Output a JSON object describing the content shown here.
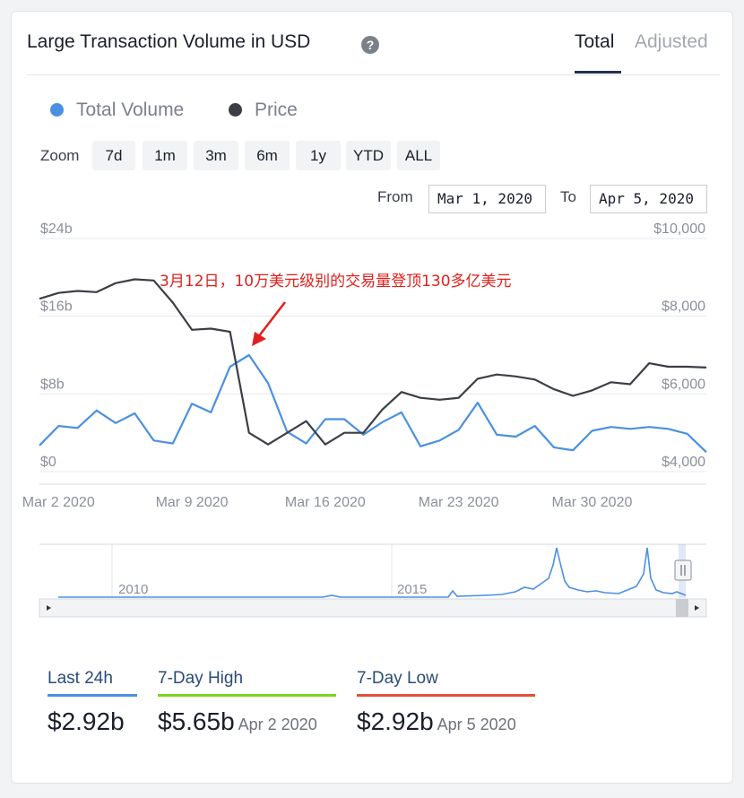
{
  "header": {
    "title": "Large Transaction Volume in USD",
    "help_icon": "question-circle-icon",
    "tabs": [
      {
        "label": "Total",
        "active": true
      },
      {
        "label": "Adjusted",
        "active": false
      }
    ]
  },
  "legend": [
    {
      "label": "Total Volume",
      "color": "#4a90e2"
    },
    {
      "label": "Price",
      "color": "#3b3f45"
    }
  ],
  "zoom": {
    "label": "Zoom",
    "options": [
      "7d",
      "1m",
      "3m",
      "6m",
      "1y",
      "YTD",
      "ALL"
    ]
  },
  "range": {
    "from_label": "From",
    "from_value": "Mar 1, 2020",
    "to_label": "To",
    "to_value": "Apr 5, 2020"
  },
  "annotation": {
    "text": "3月12日，10万美元级别的交易量登顶130多亿美元",
    "color": "#e0201b"
  },
  "chart_data": [
    {
      "type": "line",
      "x_dates": [
        "Mar 1",
        "Mar 2",
        "Mar 3",
        "Mar 4",
        "Mar 5",
        "Mar 6",
        "Mar 7",
        "Mar 8",
        "Mar 9",
        "Mar 10",
        "Mar 11",
        "Mar 12",
        "Mar 13",
        "Mar 14",
        "Mar 15",
        "Mar 16",
        "Mar 17",
        "Mar 18",
        "Mar 19",
        "Mar 20",
        "Mar 21",
        "Mar 22",
        "Mar 23",
        "Mar 24",
        "Mar 25",
        "Mar 26",
        "Mar 27",
        "Mar 28",
        "Mar 29",
        "Mar 30",
        "Mar 31",
        "Apr 1",
        "Apr 2",
        "Apr 3",
        "Apr 4",
        "Apr 5"
      ],
      "x_tick_labels": [
        "Mar 2 2020",
        "Mar 9 2020",
        "Mar 16 2020",
        "Mar 23 2020",
        "Mar 30 2020"
      ],
      "x_tick_index": [
        1,
        8,
        15,
        22,
        29
      ],
      "y_left": {
        "ticks": [
          "$0",
          "$8b",
          "$16b",
          "$24b"
        ],
        "range": [
          0,
          24
        ]
      },
      "y_right": {
        "ticks": [
          "$4,000",
          "$6,000",
          "$8,000",
          "$10,000"
        ],
        "range": [
          4000,
          10000
        ]
      },
      "series": [
        {
          "name": "Total Volume",
          "color": "#4a90e2",
          "axis": "left",
          "values": [
            2.7,
            4.7,
            4.5,
            6.3,
            5.0,
            6.0,
            3.2,
            2.9,
            7.0,
            6.1,
            10.8,
            12.0,
            9.1,
            4.1,
            2.9,
            5.4,
            5.4,
            3.8,
            5.1,
            6.1,
            2.6,
            3.2,
            4.3,
            7.1,
            3.8,
            3.6,
            4.7,
            2.5,
            2.2,
            4.2,
            4.6,
            4.4,
            4.6,
            4.4,
            3.9,
            2.0
          ]
        },
        {
          "name": "Price",
          "color": "#3b3f45",
          "axis": "right",
          "values": [
            8450,
            8600,
            8650,
            8620,
            8850,
            8950,
            8920,
            8350,
            7650,
            7680,
            7600,
            5000,
            4700,
            5000,
            5300,
            4700,
            5000,
            5000,
            5600,
            6050,
            5900,
            5850,
            5900,
            6390,
            6500,
            6450,
            6370,
            6120,
            5950,
            6090,
            6300,
            6250,
            6790,
            6700,
            6700,
            6680
          ]
        }
      ]
    },
    {
      "type": "area",
      "role": "navigator",
      "x_tick_labels": [
        "2010",
        "2015"
      ]
    }
  ],
  "stats": [
    {
      "label": "Last 24h",
      "value": "$2.92b",
      "date": "",
      "color": "#4a90e2"
    },
    {
      "label": "7-Day High",
      "value": "$5.65b",
      "date": "Apr 2 2020",
      "color": "#7ed321"
    },
    {
      "label": "7-Day Low",
      "value": "$2.92b",
      "date": "Apr 5 2020",
      "color": "#e0503a"
    }
  ]
}
